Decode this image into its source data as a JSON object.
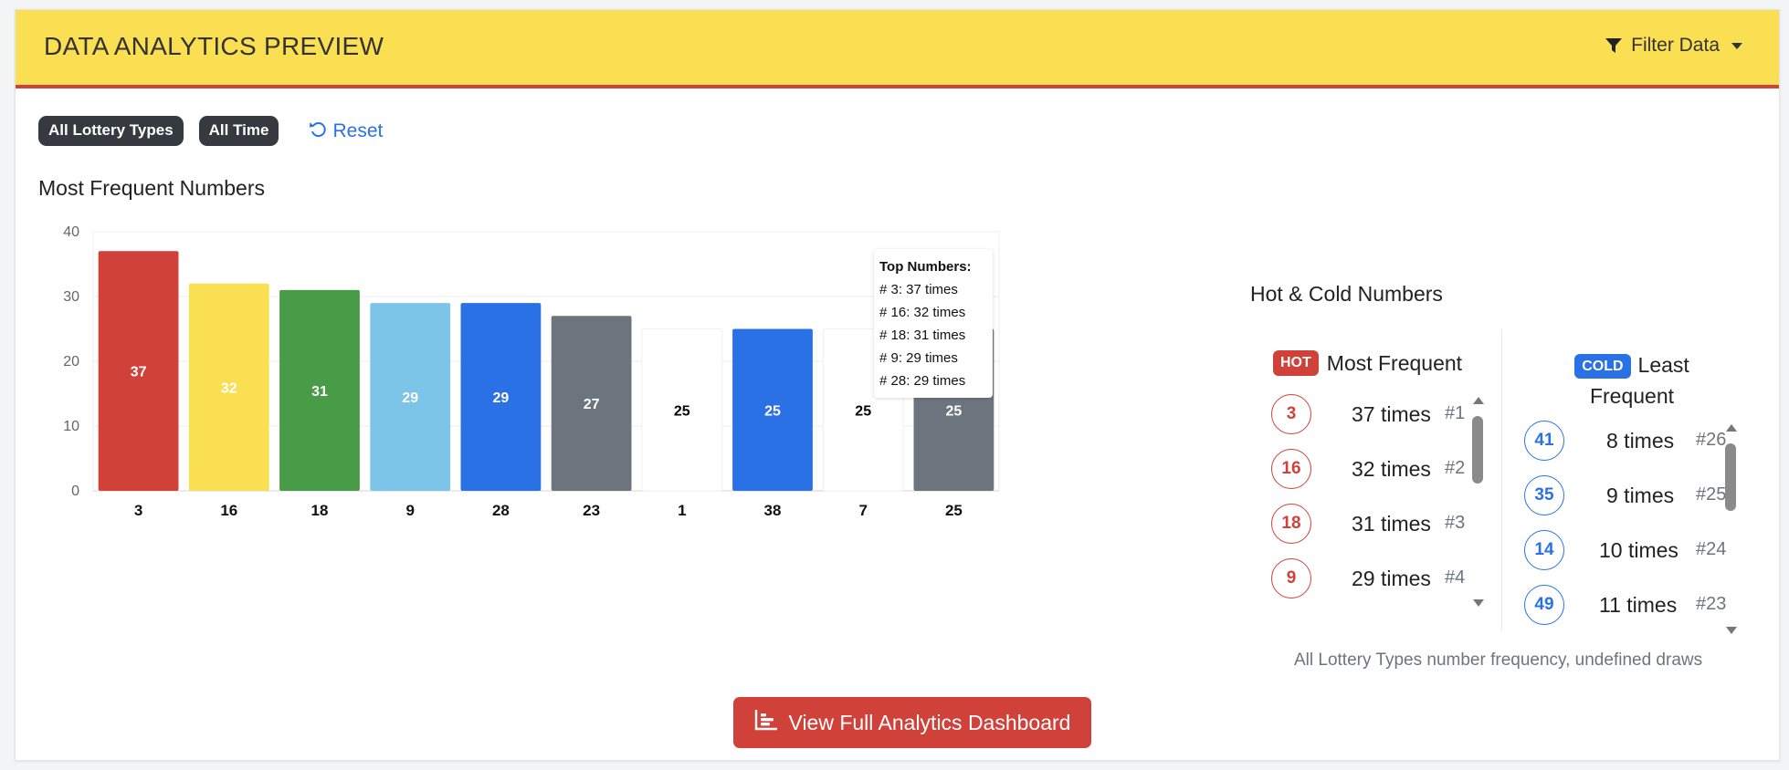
{
  "header": {
    "title": "DATA ANALYTICS PREVIEW",
    "filter_label": "Filter Data",
    "bg_color": "#fbdf52",
    "accent_color": "#d0413a"
  },
  "filters": {
    "badges": [
      "All Lottery Types",
      "All Time"
    ],
    "reset_label": "Reset"
  },
  "frequent_section": {
    "title": "Most Frequent Numbers"
  },
  "chart_data": {
    "type": "bar",
    "categories": [
      "3",
      "16",
      "18",
      "9",
      "28",
      "23",
      "1",
      "38",
      "7",
      "25"
    ],
    "values": [
      37,
      32,
      31,
      29,
      29,
      27,
      25,
      25,
      25,
      25
    ],
    "bar_colors": [
      "#d0413a",
      "#fbdf52",
      "#489b47",
      "#7cc4e8",
      "#2b71e6",
      "#6c757d",
      "#ffffff",
      "#2b71e6",
      "#ffffff",
      "#6c757d"
    ],
    "label_colors": [
      "#ffffff",
      "#ffffff",
      "#ffffff",
      "#ffffff",
      "#ffffff",
      "#ffffff",
      "#000000",
      "#ffffff",
      "#000000",
      "#ffffff"
    ],
    "yticks": [
      0,
      10,
      20,
      30,
      40
    ],
    "ylim": [
      0,
      40
    ],
    "grid": true,
    "tooltip": {
      "title": "Top Numbers:",
      "lines": [
        "# 3: 37 times",
        "# 16: 32 times",
        "# 18: 31 times",
        "# 9: 29 times",
        "# 28: 29 times"
      ]
    }
  },
  "hot_cold": {
    "title": "Hot & Cold Numbers",
    "hot": {
      "pill": "HOT",
      "heading": "Most Frequent",
      "items": [
        {
          "number": "3",
          "times": "37 times",
          "rank": "#1"
        },
        {
          "number": "16",
          "times": "32 times",
          "rank": "#2"
        },
        {
          "number": "18",
          "times": "31 times",
          "rank": "#3"
        },
        {
          "number": "9",
          "times": "29 times",
          "rank": "#4"
        }
      ]
    },
    "cold": {
      "pill": "COLD",
      "heading": "Least Frequent",
      "items": [
        {
          "number": "41",
          "times": "8 times",
          "rank": "#26"
        },
        {
          "number": "35",
          "times": "9 times",
          "rank": "#25"
        },
        {
          "number": "14",
          "times": "10 times",
          "rank": "#24"
        },
        {
          "number": "49",
          "times": "11 times",
          "rank": "#23"
        }
      ]
    },
    "caption": "All Lottery Types number frequency, undefined draws"
  },
  "cta": {
    "label": "View Full Analytics Dashboard"
  }
}
